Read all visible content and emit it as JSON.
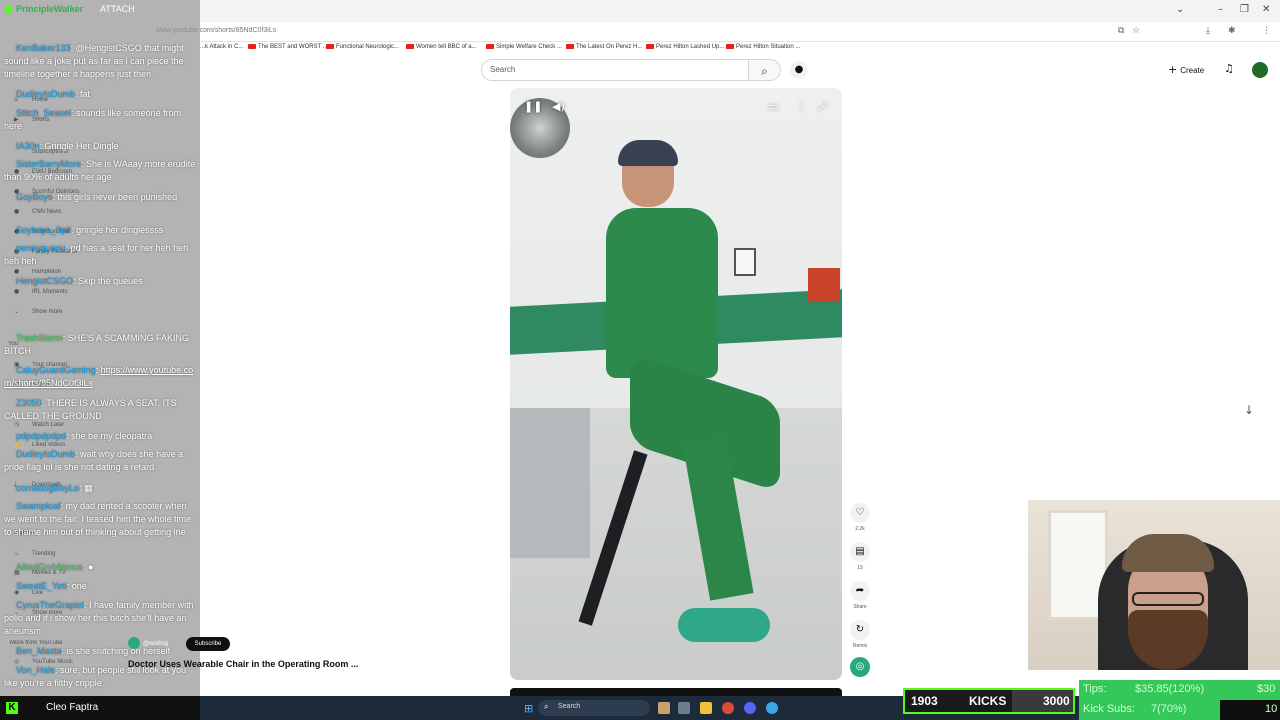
{
  "browser": {
    "url": "www.youtube.com/shorts/85NdC0f3iLs",
    "bookmarks": [
      "...k Attack in C...",
      "The BEST and WORST ...",
      "Functional Neurologic...",
      "Women tell BBC of a...",
      "Simple Welfare Check ...",
      "The Latest On Perez H...",
      "Perez Hilton Lashed Up...",
      "Perez Hilton Situation ..."
    ]
  },
  "youtube": {
    "search_placeholder": "Search",
    "create_label": "Create",
    "channel_handle": "@wisfrog",
    "subscribe_label": "Subscribe",
    "video_title": "Doctor Uses Wearable Chair in the Operating Room ...",
    "actions": [
      {
        "icon": "heart-icon",
        "label": "2.2k"
      },
      {
        "icon": "comment-icon",
        "label": "13"
      },
      {
        "icon": "share-icon",
        "label": "Share"
      },
      {
        "icon": "remix-icon",
        "label": "Remix"
      }
    ],
    "sidebar": [
      "Home",
      "Shorts",
      "Subscriptions",
      "EWU Bedroom",
      "Scornful Opinions",
      "CNN News",
      "Robinson Fan",
      "Family Research",
      "Hampleton",
      "IRL Moments",
      "Show more",
      "You",
      "Your channel",
      "History",
      "Watch Later",
      "Liked videos",
      "Downloads",
      "Explore",
      "Trending",
      "Movies & TV",
      "Live",
      "Show more",
      "More from YouTube",
      "YouTube Music"
    ]
  },
  "chat": {
    "top_username": "PrincipleWalker",
    "top_text": "ATTACH",
    "messages": [
      {
        "user": "KenBaker133",
        "text": "@HengistCSGO that might sound like a joke put as far as i can piece the timeline together it happens just then",
        "color": "#1a9bdc"
      },
      {
        "user": "DudleyIsDumb",
        "text": "fat",
        "color": "#1a9bdc"
      },
      {
        "user": "Stitch_Seasel",
        "text": "sounds like someone from here",
        "color": "#1a9bdc"
      },
      {
        "user": "IA30n",
        "text": "Gringle Her Dingle",
        "color": "#1a9bdc"
      },
      {
        "user": "SisterBarryMore",
        "text": "She is WAaay more erudite than 90% of adults her age",
        "color": "#1a9bdc"
      },
      {
        "user": "GoyBoys",
        "text": "this girls never been punished",
        "color": "#1a9bdc"
      },
      {
        "user": "Soyboys_Spit",
        "text": "gringle her dinglessss",
        "color": "#1a9bdc"
      },
      {
        "user": "pennyguanu",
        "text": "pd has a seat for her heh heh heh heh",
        "color": "#1a9bdc"
      },
      {
        "user": "HengistCSGO",
        "text": "Skip the queues",
        "color": "#1a9bdc"
      },
      {
        "user": "TrashStorm",
        "text": "SHE'S A SCAMMING FAKING BITCH",
        "color": "#3ec15a"
      },
      {
        "user": "CaluyGuardGaming",
        "text": "https://www.youtube.com/shorts/85NdC0f3iLs",
        "color": "#1a9bdc"
      },
      {
        "user": "Z3050",
        "text": "THERE IS ALWAYS A SEAT. ITS CALLED THE GROUND",
        "color": "#1a9bdc"
      },
      {
        "user": "pdpdpdpdpd",
        "text": "she be my cleopatra",
        "color": "#1a9bdc"
      },
      {
        "user": "DudleyIsDumb",
        "text": "wait why does she have a pride flag lol is she not dating a retard",
        "color": "#1a9bdc"
      },
      {
        "user": "cornadogBoyLo",
        "text": "",
        "color": "#1a9bdc"
      },
      {
        "user": "Swamploaf",
        "text": "my dad rented a scooter when we went to the fair. I teased him the whole time to shame him out of thinking about getting ine",
        "color": "#1a9bdc"
      },
      {
        "user": "AlliedGrvbNexus",
        "text": "",
        "color": "#3ec15a"
      },
      {
        "user": "SweatE_Yeti",
        "text": "one",
        "color": "#1a9bdc"
      },
      {
        "user": "CyrusTheGrapist",
        "text": "I have family member with polio and if i show her this bitch she'll have an aneurism",
        "color": "#1a9bdc"
      },
      {
        "user": "Ben_Masta",
        "text": "is she snitching on herself",
        "color": "#1a9bdc"
      },
      {
        "user": "Von_Hale",
        "text": "sure, but people still look at you like you're a filthy cripple.",
        "color": "#1a9bdc"
      }
    ],
    "input_name": "Cleo Faptra"
  },
  "taskbar": {
    "search_label": "Search"
  },
  "stream_stats": {
    "kicks_current": "1903",
    "kicks_label": "KICKS",
    "kicks_goal": "3000",
    "kicks_progress": 0.634,
    "tips_label": "Tips:",
    "tips_value": "$35.85(120%)",
    "tips_goal": "$30",
    "tips_progress": 1.0,
    "subs_label": "Kick Subs:",
    "subs_value": "7(70%)",
    "subs_goal": "10",
    "subs_progress": 0.7,
    "accent": "#53fc18"
  }
}
